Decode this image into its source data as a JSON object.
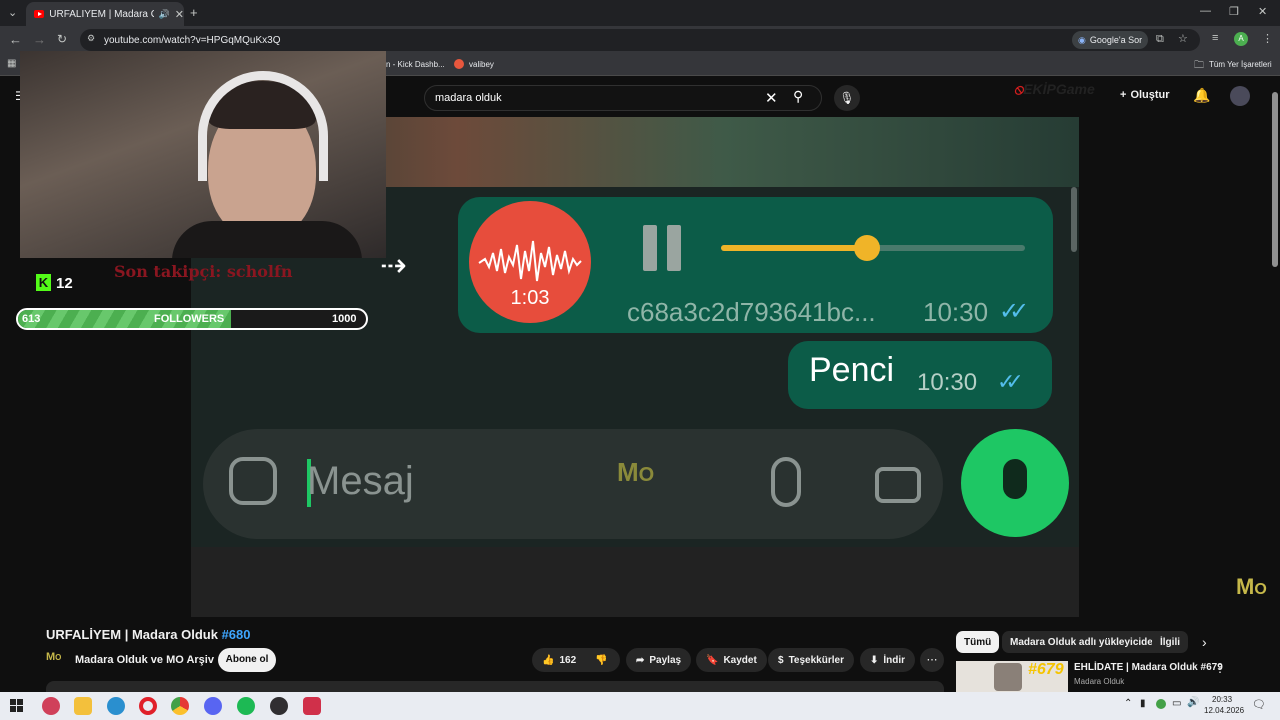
{
  "browser": {
    "tab_title": "URFALİYEM | Madara Olduk",
    "url": "youtube.com/watch?v=HPGqMQuKx3Q",
    "google_sor": "Google'a Sor",
    "profile_initial": "A",
    "bookmarks": [
      "n - Kick Dashb...",
      "valibey"
    ],
    "all_bookmarks": "Tüm Yer İşaretleri"
  },
  "youtube": {
    "search_value": "madara olduk",
    "create_label": "Oluştur",
    "video": {
      "voice_duration": "1:03",
      "voice_file": "c68a3c2d793641bc...",
      "voice_time": "10:30",
      "text_message": "Penci",
      "text_time": "10:30",
      "input_placeholder": "Mesaj",
      "progress": 0.48
    },
    "overlay": {
      "kick_count": "12",
      "last_follower": "Son takipçi: scholfn",
      "followers_current": "613",
      "followers_label": "FOLLOWERS",
      "followers_goal": "1000",
      "followers_progress": 0.613
    },
    "title": "URFALİYEM | Madara Olduk",
    "episode": "#680",
    "channel_name": "Madara Olduk ve MO Arşiv",
    "subscribe_label": "Abone ol",
    "likes": "162",
    "share_label": "Paylaş",
    "save_label": "Kaydet",
    "thanks_label": "Teşekkürler",
    "download_label": "İndir",
    "chips": [
      "Tümü",
      "Madara Olduk adlı yükleyiciden",
      "İlgili"
    ],
    "recommend": {
      "title": "EHLİDATE | Madara Olduk #679",
      "channel": "Madara Olduk",
      "thumb_label": "#679"
    }
  },
  "taskbar": {
    "time": "20:33",
    "date": "12.04.2026"
  },
  "colors": {
    "accent_link": "#3ea6ff",
    "wa_green": "#1ec764",
    "bubble": "#0c5c48",
    "voice_red": "#e74d3c",
    "kick_green": "#53fc18"
  }
}
